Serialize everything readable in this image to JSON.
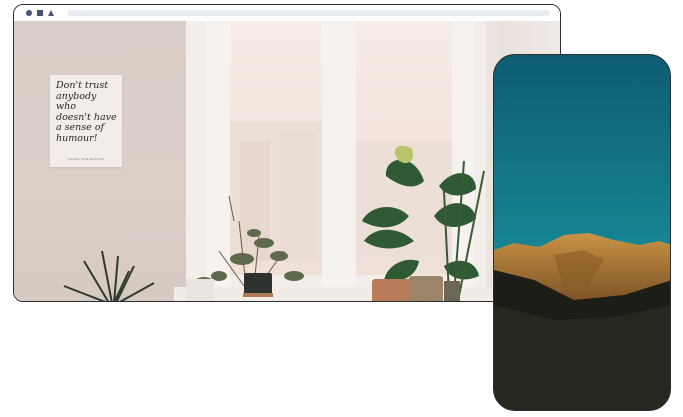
{
  "browser": {
    "controls": [
      "circle-icon",
      "square-icon",
      "triangle-icon"
    ]
  },
  "desktop_scene": {
    "poster_text": "Don't trust\nanybody who\ndoesn't have\na sense of\nhumour!",
    "poster_credit": "LAURA STEVENSON"
  },
  "colors": {
    "frame": "#2b2d33",
    "chrome_icons": "#4a5373",
    "sky_top": "#0e5c72",
    "sky_bottom": "#1ea0a8",
    "mountain": "#b98a3e"
  }
}
